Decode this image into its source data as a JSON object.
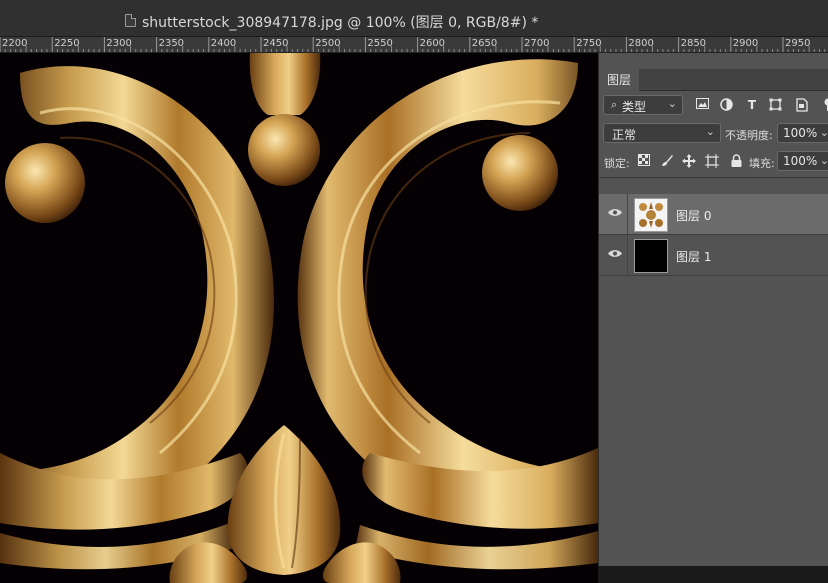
{
  "document": {
    "title": "shutterstock_308947178.jpg @ 100% (图层 0, RGB/8#) *"
  },
  "ruler": {
    "labels": [
      "2200",
      "2250",
      "2300",
      "2350",
      "2400",
      "2450",
      "2500",
      "2550",
      "2600",
      "2650",
      "2700",
      "2750",
      "2800",
      "2850",
      "2900",
      "2950"
    ]
  },
  "panel": {
    "close_label": "×",
    "tab": "图层",
    "filter": {
      "search_glyph": "⌕",
      "label": "类型",
      "icons": [
        "image-icon",
        "adjustment-icon",
        "type-icon",
        "shape-icon",
        "smart-object-icon"
      ],
      "type_glyph": "T"
    },
    "blend_mode": "正常",
    "opacity_label": "不透明度:",
    "opacity_value": "100%",
    "lock_label": "锁定:",
    "fill_label": "填充:",
    "fill_value": "100%",
    "layers": [
      {
        "name": "图层 0",
        "selected": true,
        "visible": true,
        "thumb": "ornament"
      },
      {
        "name": "图层 1",
        "selected": false,
        "visible": true,
        "thumb": "black"
      }
    ]
  },
  "colors": {
    "canvas_bg": "#050003",
    "gold_light": "#f0d28a",
    "gold_mid": "#c28f3a",
    "gold_dark": "#6a3f12",
    "panel_bg": "#535353",
    "selected_row": "#6b6b6b"
  }
}
